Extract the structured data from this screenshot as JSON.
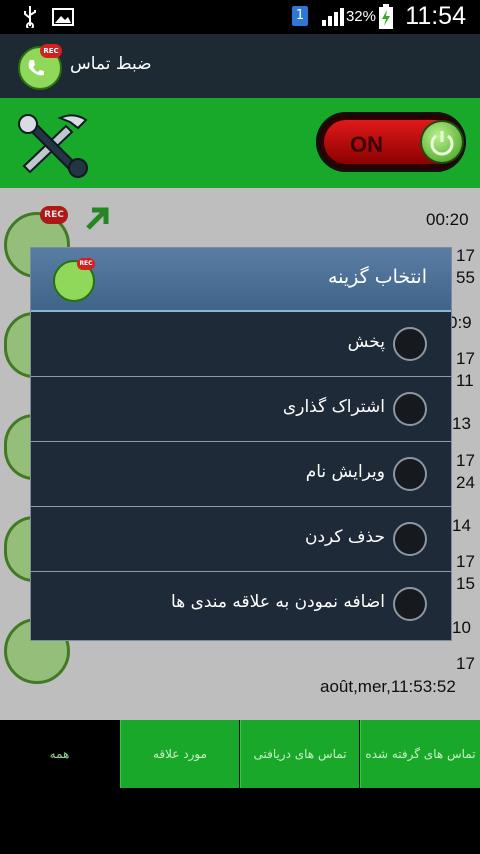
{
  "status_bar": {
    "time": "11:54",
    "battery_percent": "32%",
    "sim_badge": "1",
    "icons": [
      "usb-icon",
      "image-icon",
      "sim-icon",
      "signal-icon",
      "battery-charging-icon"
    ]
  },
  "app_bar": {
    "title": "ضبط تماس",
    "logo_badge": "REC"
  },
  "header": {
    "settings_icon": "tools-icon",
    "toggle_label": "ON",
    "toggle_state": "on",
    "accent_color": "#19a92a"
  },
  "list": {
    "visible_texts": [
      {
        "text": "00:20"
      },
      {
        "text": "17"
      },
      {
        "text": "55"
      },
      {
        "text": "0:9"
      },
      {
        "text": "17"
      },
      {
        "text": "11"
      },
      {
        "text": "13"
      },
      {
        "text": "17"
      },
      {
        "text": "24"
      },
      {
        "text": "14"
      },
      {
        "text": "17"
      },
      {
        "text": "15"
      },
      {
        "text": "10"
      },
      {
        "text": "17"
      },
      {
        "text": "août,mer,11:53:52"
      }
    ]
  },
  "dialog": {
    "title": "انتخاب گزینه",
    "options": [
      {
        "label": "پخش"
      },
      {
        "label": "اشتراک گذاری"
      },
      {
        "label": "ویرایش نام"
      },
      {
        "label": "حذف کردن"
      },
      {
        "label": "اضافه نمودن به علاقه مندی ها"
      }
    ]
  },
  "tabs": [
    {
      "label": "تماس های گرفته شده",
      "selected": false
    },
    {
      "label": "تماس های دریافتی",
      "selected": false
    },
    {
      "label": "مورد علاقه",
      "selected": false
    },
    {
      "label": "همه",
      "selected": true
    }
  ]
}
